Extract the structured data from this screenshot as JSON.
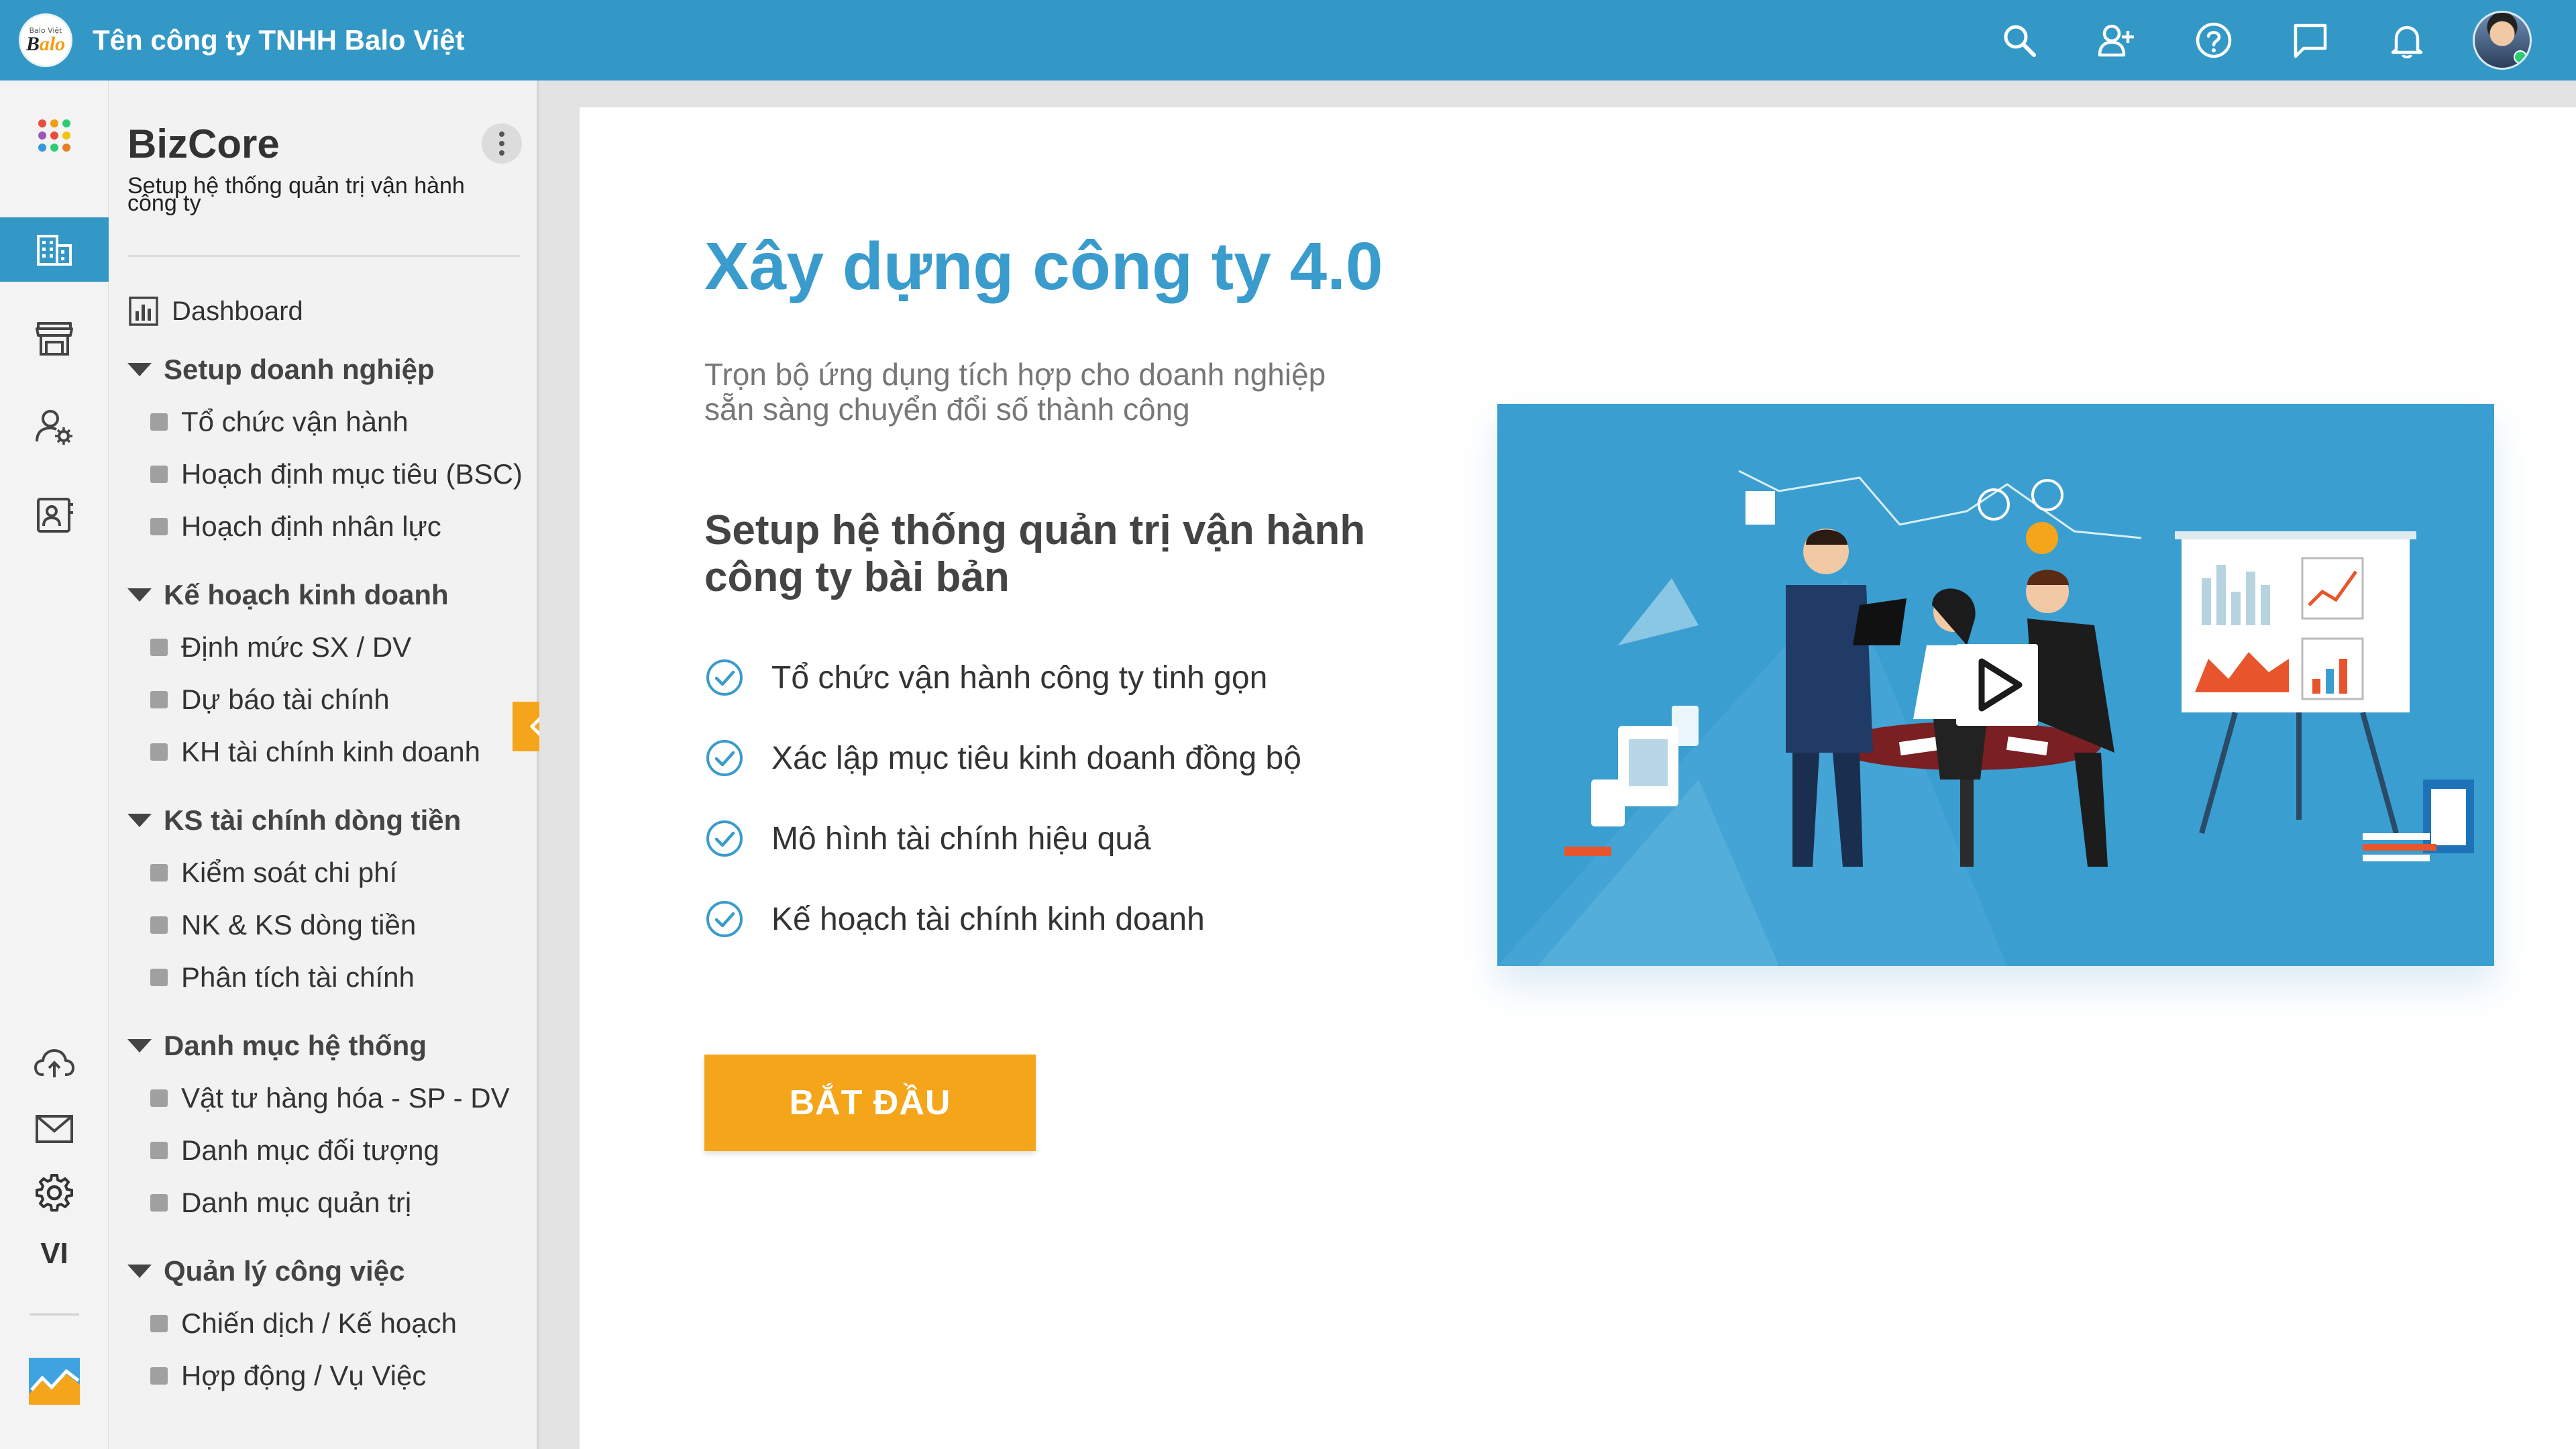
{
  "topbar": {
    "logo": {
      "small": "Balo Việt",
      "big_left": "B",
      "big_right": "alo"
    },
    "company_name": "Tên công ty TNHH Balo Việt",
    "icons": [
      "search-icon",
      "add-user-icon",
      "help-icon",
      "chat-icon",
      "bell-icon"
    ]
  },
  "rail": {
    "items": [
      "apps-grid-icon",
      "building-icon",
      "store-icon",
      "user-settings-icon",
      "contact-card-icon"
    ],
    "bottom_items": [
      "cloud-upload-icon",
      "mail-icon",
      "gear-icon"
    ],
    "language": "VI",
    "chart_app": "chart-app-icon"
  },
  "sidebar": {
    "title": "BizCore",
    "subtitle": "Setup hệ thống quản trị vận hành công ty",
    "dashboard": "Dashboard",
    "sections": [
      {
        "label": "Setup doanh nghiệp",
        "items": [
          "Tổ chức vận hành",
          "Hoạch định mục tiêu (BSC)",
          "Hoạch định nhân lực"
        ]
      },
      {
        "label": "Kế hoạch kinh doanh",
        "items": [
          "Định mức SX / DV",
          "Dự báo tài chính",
          "KH tài chính kinh doanh"
        ]
      },
      {
        "label": "KS tài chính dòng tiền",
        "items": [
          "Kiểm soát chi phí",
          "NK & KS dòng tiền",
          "Phân tích tài chính"
        ]
      },
      {
        "label": "Danh mục hệ thống",
        "items": [
          "Vật tư hàng hóa - SP - DV",
          "Danh mục đối tượng",
          "Danh mục quản trị"
        ]
      },
      {
        "label": "Quản lý công việc",
        "items": [
          "Chiến dịch / Kế hoạch",
          "Hợp động / Vụ Việc"
        ]
      }
    ]
  },
  "main": {
    "title": "Xây dựng công ty 4.0",
    "subtitle": "Trọn bộ ứng dụng tích hợp cho doanh nghiệp sẵn sàng chuyển đổi số thành công",
    "heading": "Setup hệ thống quản trị vận hành công ty bài bản",
    "features": [
      "Tổ chức vận hành công ty tinh gọn",
      "Xác lập mục tiêu kinh doanh đồng bộ",
      "Mô hình tài chính hiệu quả",
      "Kế hoạch tài chính kinh doanh"
    ],
    "start_button": "BẮT ĐẦU"
  },
  "colors": {
    "primary": "#3498c6",
    "accent": "#f5a519",
    "title": "#3a9bcd"
  }
}
